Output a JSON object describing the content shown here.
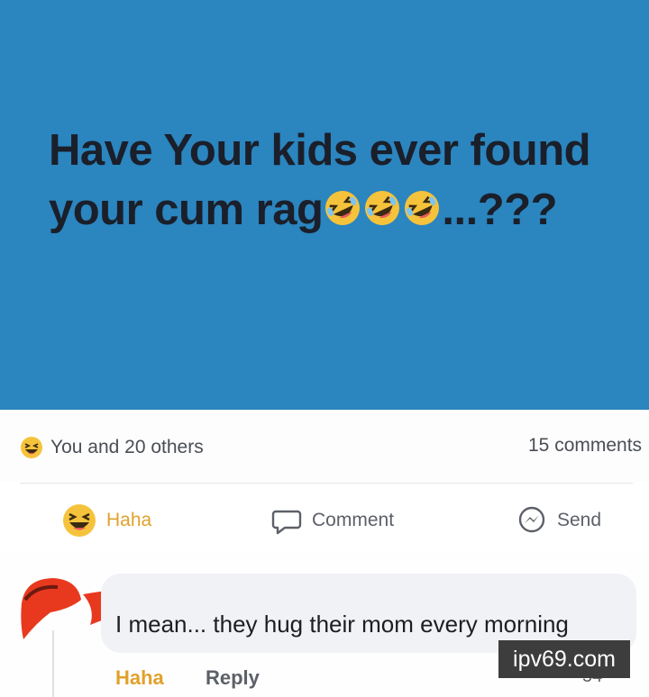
{
  "post": {
    "line1": "Have Your kids ever found",
    "line2_prefix": "your cum rag",
    "line2_suffix": "...???",
    "emojis": [
      "rolling-on-floor-laughing",
      "rolling-on-floor-laughing",
      "rolling-on-floor-laughing"
    ],
    "background_color": "#2b85bf"
  },
  "stats": {
    "reactions_text": "You and 20 others",
    "comments_text": "15 comments",
    "reaction_icon": "haha-icon"
  },
  "actions": {
    "haha_label": "Haha",
    "comment_label": "Comment",
    "send_label": "Send"
  },
  "comment": {
    "text": "I mean... they hug their mom every morning",
    "haha_label": "Haha",
    "reply_label": "Reply",
    "reaction_count": "54"
  },
  "watermark": {
    "text": "ipv69.com"
  },
  "colors": {
    "haha_accent": "#e1a12c",
    "redaction": "#e8391f"
  }
}
